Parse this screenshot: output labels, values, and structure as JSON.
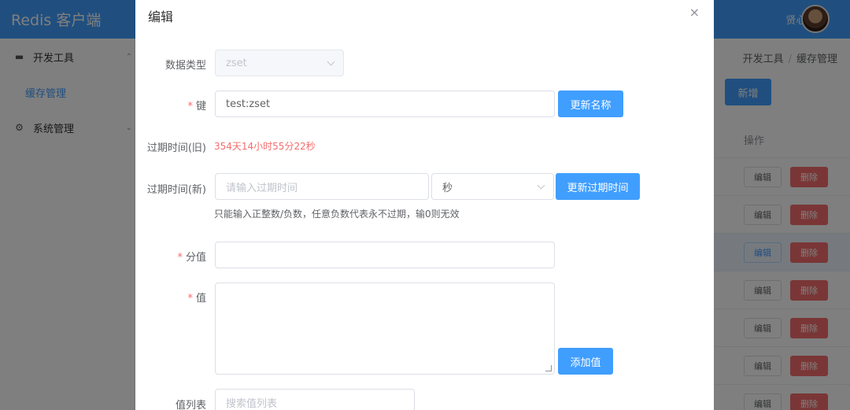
{
  "app": {
    "title": "Redis 客户端",
    "user_name": "贤心i"
  },
  "sidebar": {
    "items": [
      {
        "label": "开发工具",
        "icon": "monitor-icon",
        "expanded": true
      },
      {
        "label": "缓存管理"
      },
      {
        "label": "系统管理",
        "icon": "gear-icon",
        "expanded": false
      }
    ]
  },
  "breadcrumb": [
    "开发工具",
    "/",
    "缓存管理"
  ],
  "background": {
    "add_button": "新增",
    "table_header_action": "操作",
    "row_edit": "编辑",
    "row_delete": "删除"
  },
  "dialog": {
    "title": "编辑",
    "close": "×",
    "data_type": {
      "label": "数据类型",
      "value": "zset"
    },
    "key": {
      "label": "键",
      "value": "test:zset",
      "button": "更新名称"
    },
    "expire_old": {
      "label": "过期时间(旧)",
      "value": "354天14小时55分22秒"
    },
    "expire_new": {
      "label": "过期时间(新)",
      "placeholder": "请输入过期时间",
      "unit": "秒",
      "button": "更新过期时间",
      "hint": "只能输入正整数/负数，任意负数代表永不过期，输0则无效"
    },
    "score": {
      "label": "分值",
      "value": ""
    },
    "value": {
      "label": "值",
      "value": "",
      "button": "添加值"
    },
    "value_list": {
      "label": "值列表",
      "placeholder": "搜索值列表"
    }
  },
  "colors": {
    "primary": "#409eff",
    "danger": "#f56c6c",
    "required": "#f56c6c"
  }
}
